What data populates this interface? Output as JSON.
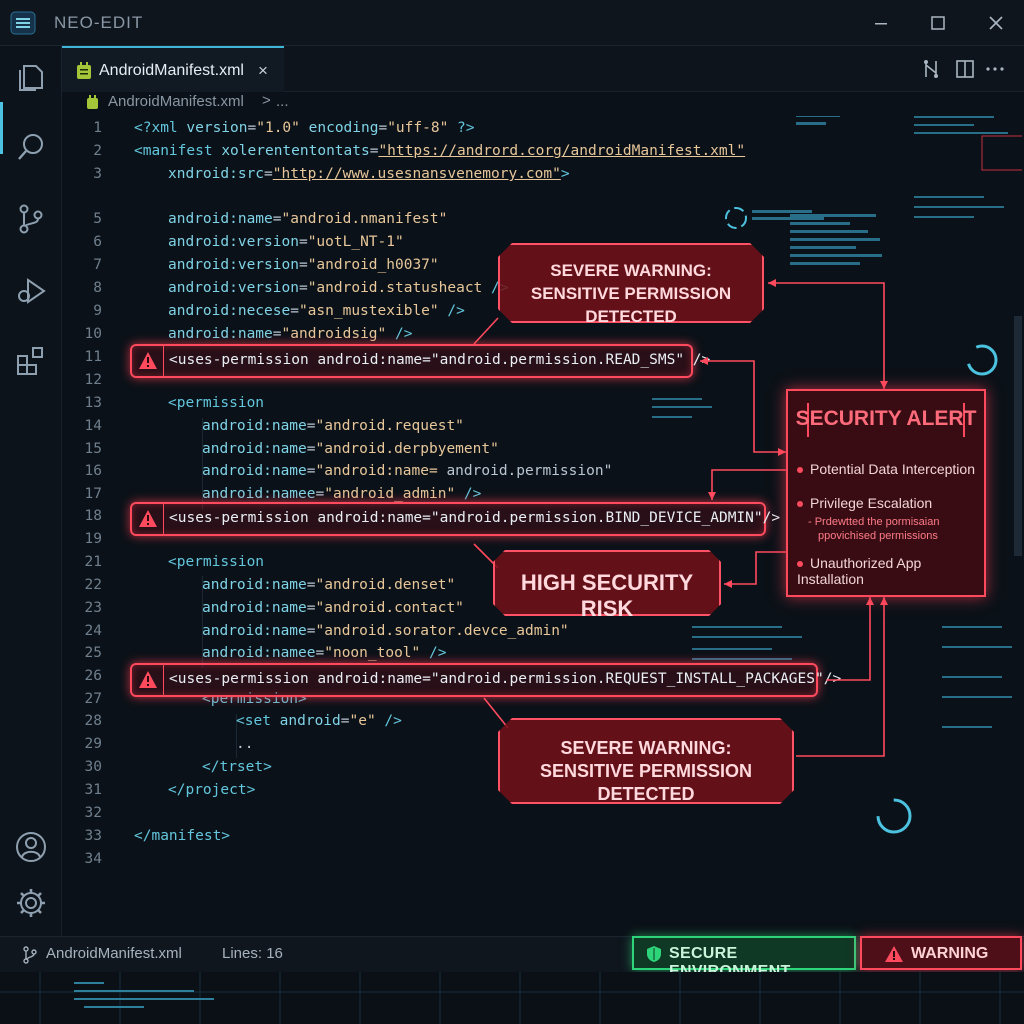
{
  "window": {
    "title": "NEO-EDIT"
  },
  "tabs": [
    {
      "label": "AndroidManifest.xml",
      "close": "×"
    }
  ],
  "breadcrumb": {
    "file": "AndroidManifest.xml",
    "separator": ">",
    "more": "..."
  },
  "code_lines": [
    {
      "n": "1",
      "tokens": [
        [
          "t",
          "<?xml "
        ],
        [
          "a",
          "version"
        ],
        [
          "p",
          "="
        ],
        [
          "s",
          "\"1.0\""
        ],
        [
          "p",
          " "
        ],
        [
          "a",
          "encoding"
        ],
        [
          "p",
          "="
        ],
        [
          "s",
          "\"uff-8\""
        ],
        [
          "t",
          " ?>"
        ]
      ],
      "indent": 0
    },
    {
      "n": "2",
      "tokens": [
        [
          "t",
          "<manifest "
        ],
        [
          "a",
          "xolerententontats"
        ],
        [
          "p",
          "="
        ],
        [
          "u",
          "\"https://andrord.corg/androidManifest.xml\""
        ]
      ],
      "indent": 0
    },
    {
      "n": "3",
      "tokens": [
        [
          "a",
          "xndroid:src"
        ],
        [
          "p",
          "="
        ],
        [
          "u",
          "\"http://www.usesnansvenemory.com\""
        ],
        [
          "t",
          ">"
        ]
      ],
      "indent": 1
    },
    {
      "n": "5",
      "tokens": [
        [
          "a",
          "android:name"
        ],
        [
          "p",
          "="
        ],
        [
          "s",
          "\"android.nmanifest\""
        ]
      ],
      "indent": 1
    },
    {
      "n": "6",
      "tokens": [
        [
          "a",
          "android:version"
        ],
        [
          "p",
          "="
        ],
        [
          "s",
          "\"uotL_NT-1\""
        ]
      ],
      "indent": 1
    },
    {
      "n": "7",
      "tokens": [
        [
          "a",
          "android:version"
        ],
        [
          "p",
          "="
        ],
        [
          "s",
          "\"android_h0037\""
        ]
      ],
      "indent": 1
    },
    {
      "n": "8",
      "tokens": [
        [
          "a",
          "android:version"
        ],
        [
          "p",
          "="
        ],
        [
          "s",
          "\"android.statusheact"
        ],
        [
          "t",
          " />"
        ]
      ],
      "indent": 1
    },
    {
      "n": "9",
      "tokens": [
        [
          "a",
          "android:necese"
        ],
        [
          "p",
          "="
        ],
        [
          "s",
          "\"asn_mustexible\""
        ],
        [
          "t",
          " />"
        ]
      ],
      "indent": 1
    },
    {
      "n": "10",
      "tokens": [
        [
          "a",
          "android:name"
        ],
        [
          "p",
          "="
        ],
        [
          "s",
          "\"androidsig\""
        ],
        [
          "t",
          " />"
        ]
      ],
      "indent": 1
    },
    {
      "n": "11",
      "tokens": [],
      "indent": 1
    },
    {
      "n": "12",
      "tokens": [],
      "indent": 0
    },
    {
      "n": "13",
      "tokens": [
        [
          "t",
          "<permission"
        ]
      ],
      "indent": 1
    },
    {
      "n": "14",
      "tokens": [
        [
          "a",
          "android:name"
        ],
        [
          "p",
          "="
        ],
        [
          "s",
          "\"android.request\""
        ]
      ],
      "indent": 2
    },
    {
      "n": "15",
      "tokens": [
        [
          "a",
          "android:name"
        ],
        [
          "p",
          "="
        ],
        [
          "s",
          "\"android.derpbyement\""
        ]
      ],
      "indent": 2
    },
    {
      "n": "16",
      "tokens": [
        [
          "a",
          "android:name"
        ],
        [
          "p",
          "="
        ],
        [
          "s",
          "\"android:name="
        ],
        [
          "p",
          " android.permission\""
        ]
      ],
      "indent": 2
    },
    {
      "n": "17",
      "tokens": [
        [
          "a",
          "android:namee"
        ],
        [
          "p",
          "="
        ],
        [
          "s",
          "\"android_admin\""
        ],
        [
          "t",
          " />"
        ]
      ],
      "indent": 2
    },
    {
      "n": "18",
      "tokens": [],
      "indent": 1
    },
    {
      "n": "19",
      "tokens": [],
      "indent": 0
    },
    {
      "n": "21",
      "tokens": [
        [
          "t",
          "<permission"
        ]
      ],
      "indent": 1
    },
    {
      "n": "22",
      "tokens": [
        [
          "a",
          "android:name"
        ],
        [
          "p",
          "="
        ],
        [
          "s",
          "\"android.denset\""
        ]
      ],
      "indent": 2
    },
    {
      "n": "23",
      "tokens": [
        [
          "a",
          "android:name"
        ],
        [
          "p",
          "="
        ],
        [
          "s",
          "\"android.contact\""
        ]
      ],
      "indent": 2
    },
    {
      "n": "24",
      "tokens": [
        [
          "a",
          "android:name"
        ],
        [
          "p",
          "="
        ],
        [
          "s",
          "\"android.sorator.devce_admin\""
        ]
      ],
      "indent": 2
    },
    {
      "n": "25",
      "tokens": [
        [
          "a",
          "android:namee"
        ],
        [
          "p",
          "="
        ],
        [
          "s",
          "\"noon_tool\""
        ],
        [
          "t",
          " />"
        ]
      ],
      "indent": 2
    },
    {
      "n": "26",
      "tokens": [],
      "indent": 1
    },
    {
      "n": "27",
      "tokens": [
        [
          "t",
          "<permission>"
        ]
      ],
      "indent": 2
    },
    {
      "n": "28",
      "tokens": [
        [
          "t",
          "<set "
        ],
        [
          "a",
          "android"
        ],
        [
          "p",
          "="
        ],
        [
          "s",
          "\"e\""
        ],
        [
          "t",
          " />"
        ]
      ],
      "indent": 3
    },
    {
      "n": "29",
      "tokens": [
        [
          "p",
          ".."
        ]
      ],
      "indent": 3
    },
    {
      "n": "30",
      "tokens": [
        [
          "t",
          "</trset>"
        ]
      ],
      "indent": 2
    },
    {
      "n": "31",
      "tokens": [
        [
          "t",
          "</project>"
        ]
      ],
      "indent": 1
    },
    {
      "n": "32",
      "tokens": [],
      "indent": 0
    },
    {
      "n": "33",
      "tokens": [
        [
          "t",
          "</manifest>"
        ]
      ],
      "indent": 0
    },
    {
      "n": "34",
      "tokens": [],
      "indent": 0
    }
  ],
  "highlighted_permissions": [
    {
      "line": "11",
      "text": "<uses-permission android:name=\"android.permission.READ_SMS\" />"
    },
    {
      "line": "18",
      "text": "<uses-permission android:name=\"android.permission.BIND_DEVICE_ADMIN\"/>"
    },
    {
      "line": "26",
      "text": "<uses-permission android:name=\"android.permission.REQUEST_INSTALL_PACKAGES\"/>"
    }
  ],
  "callouts": {
    "top": [
      "SEVERE WARNING:",
      "SENSITIVE PERMISSION DETECTED"
    ],
    "middle": [
      "HIGH SECURITY RISK"
    ],
    "bottom": [
      "SEVERE WARNING:",
      "SENSITIVE PERMISSION DETECTED"
    ]
  },
  "security_alert": {
    "title": "SECURITY ALERT",
    "items": [
      "Potential Data Interception",
      "Privilege Escalation",
      "Unauthorized App Installation"
    ],
    "sub_items": [
      "- Prdewtted the pormisaian",
      "ppovichised permissions"
    ]
  },
  "statusbar": {
    "file": "AndroidManifest.xml",
    "lines": "Lines: 16",
    "secure": "SECURE ENVIRONMENT",
    "warning": "WARNING"
  },
  "colors": {
    "accent": "#3fb6d6",
    "danger": "#ff4a5e",
    "safe": "#2ed47a",
    "bg": "#0b1118"
  },
  "icons": [
    "menu-icon",
    "files-icon",
    "search-icon",
    "source-control-icon",
    "run-debug-icon",
    "extensions-icon",
    "account-icon",
    "settings-icon",
    "xml-file-icon",
    "compare-icon",
    "split-editor-icon",
    "more-icon",
    "branch-icon",
    "shield-icon",
    "warning-icon"
  ]
}
